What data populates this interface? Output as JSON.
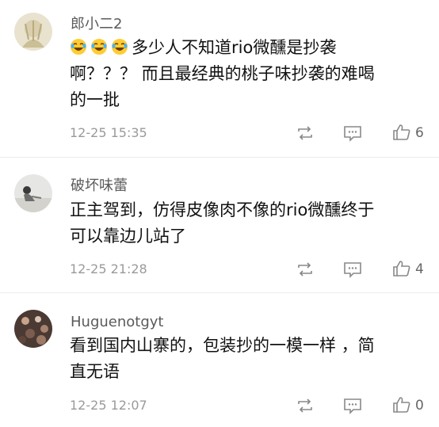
{
  "comments": [
    {
      "username": "郎小二2",
      "text_lines": [
        "多少人不知道rio微醺是抄袭",
        "啊？？？ 而且最经典的桃子味抄袭的难喝",
        "的一批"
      ],
      "emoji_count": 3,
      "emoji_icon": "laughing-crying-emoji-icon",
      "timestamp": "12-25 15:35",
      "likes": "6"
    },
    {
      "username": "破坏味蕾",
      "text_lines": [
        "正主驾到，仿得皮像肉不像的rio微醺终于",
        "可以靠边儿站了"
      ],
      "timestamp": "12-25 21:28",
      "likes": "4"
    },
    {
      "username": "Huguenotgyt",
      "text_lines": [
        "看到国内山寨的，包装抄的一模一样 ，简",
        "直无语"
      ],
      "timestamp": "12-25 12:07",
      "likes": "0"
    }
  ],
  "icons": {
    "repost": "repost-icon",
    "comment": "comment-icon",
    "like": "thumbs-up-icon"
  },
  "colors": {
    "text": "#111111",
    "meta": "#9a9a9a",
    "username": "#5a5a5a",
    "icon": "#888888"
  }
}
